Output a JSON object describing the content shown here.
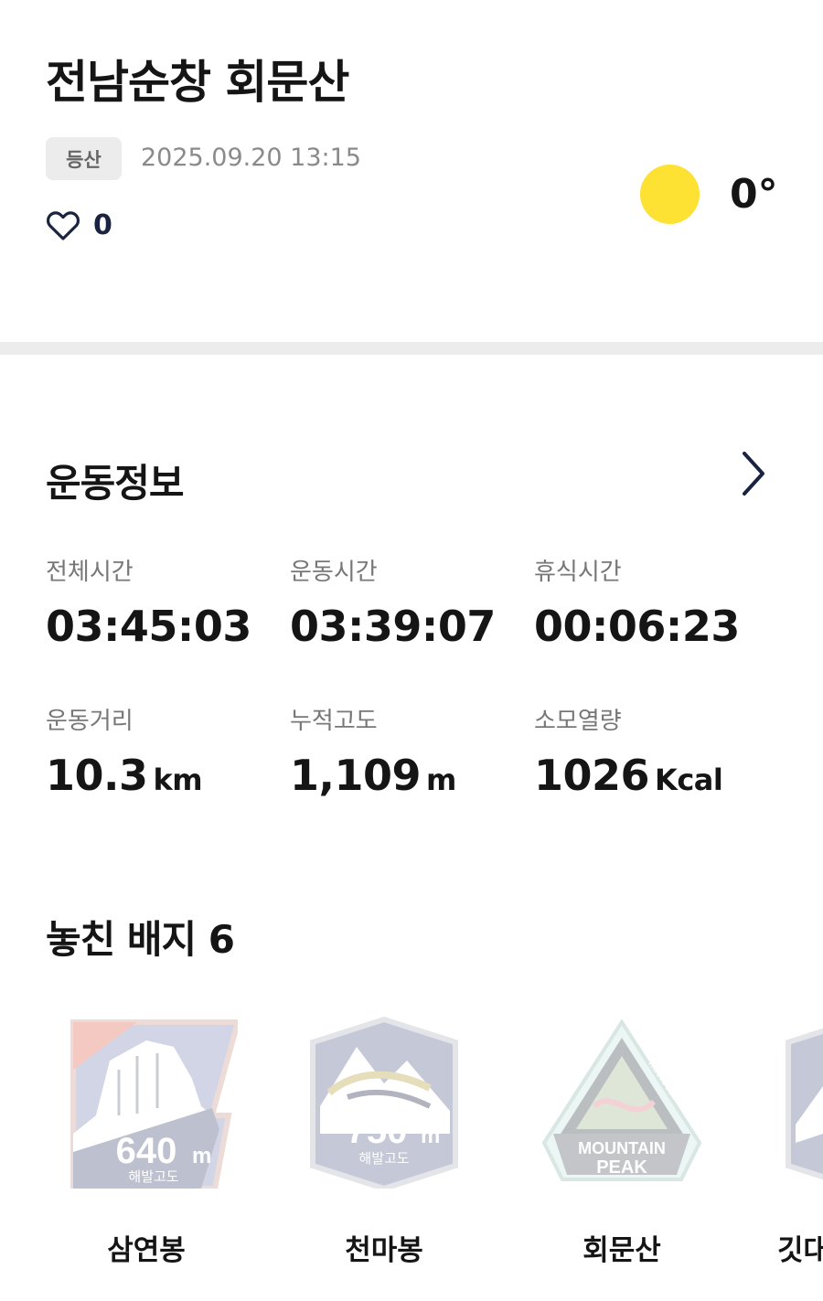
{
  "header": {
    "title": "전남순창 회문산",
    "tag": "등산",
    "datetime": "2025.09.20 13:15",
    "like_count": "0",
    "temperature": "0°"
  },
  "exercise": {
    "title": "운동정보",
    "stats": [
      {
        "label": "전체시간",
        "value": "03:45:03",
        "unit": ""
      },
      {
        "label": "운동시간",
        "value": "03:39:07",
        "unit": ""
      },
      {
        "label": "휴식시간",
        "value": "00:06:23",
        "unit": ""
      },
      {
        "label": "운동거리",
        "value": "10.3",
        "unit": "km"
      },
      {
        "label": "누적고도",
        "value": "1,109",
        "unit": "m"
      },
      {
        "label": "소모열량",
        "value": "1026",
        "unit": "Kcal"
      }
    ]
  },
  "badges": {
    "title": "놓친 배지 6",
    "items": [
      {
        "name": "삼연봉",
        "altitude": "640",
        "unit": "m",
        "sub": "해발고도"
      },
      {
        "name": "천마봉",
        "altitude": "750",
        "unit": "m",
        "sub": "해발고도"
      },
      {
        "name": "회문산",
        "line1": "MOUNTAIN",
        "line2": "PEAK",
        "mark": "TRANGGLE"
      },
      {
        "name": "깃대"
      }
    ]
  },
  "colors": {
    "sun": "#fde133",
    "divider": "#ececec",
    "tag_bg": "#ececec",
    "like_icon": "#1a2340"
  }
}
